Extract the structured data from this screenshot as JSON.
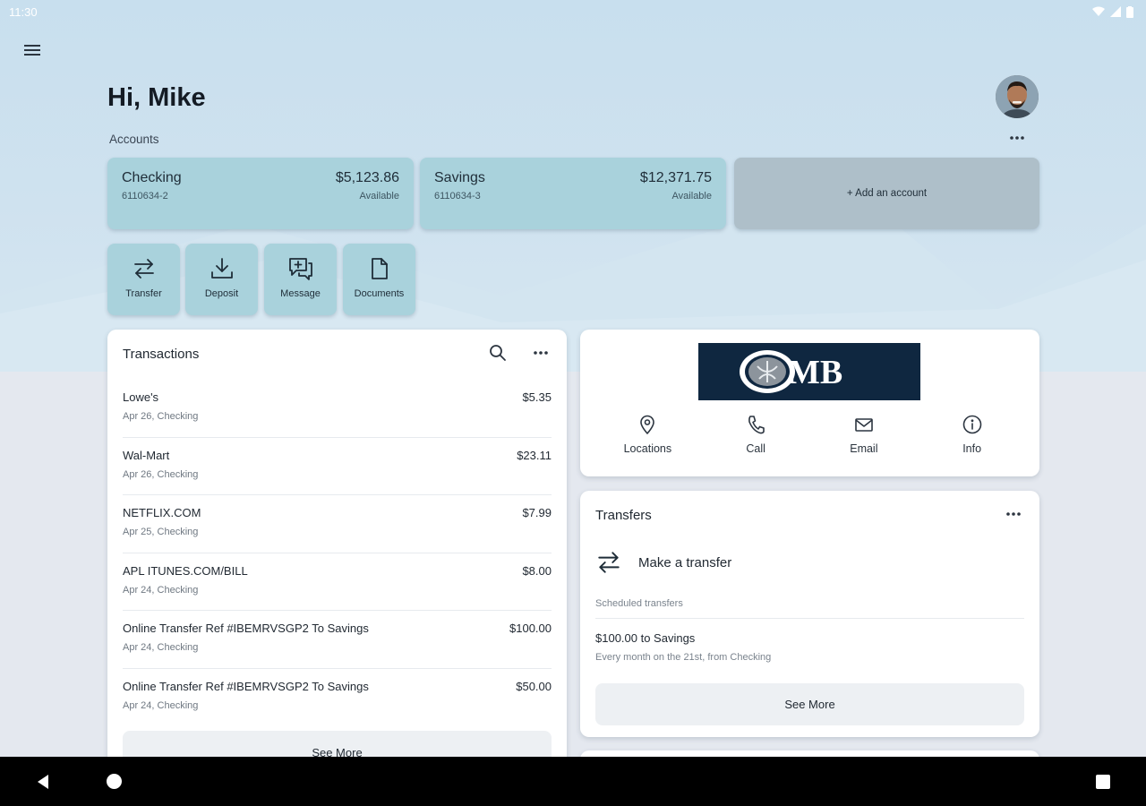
{
  "status_bar": {
    "time": "11:30"
  },
  "header": {
    "greeting": "Hi, Mike"
  },
  "accounts": {
    "label": "Accounts",
    "items": [
      {
        "name": "Checking",
        "number": "6110634-2",
        "amount": "$5,123.86",
        "available_label": "Available"
      },
      {
        "name": "Savings",
        "number": "6110634-3",
        "amount": "$12,371.75",
        "available_label": "Available"
      }
    ],
    "add_label": "+ Add an account"
  },
  "actions": [
    {
      "label": "Transfer",
      "icon": "transfer-icon"
    },
    {
      "label": "Deposit",
      "icon": "deposit-icon"
    },
    {
      "label": "Message",
      "icon": "message-icon"
    },
    {
      "label": "Documents",
      "icon": "document-icon"
    }
  ],
  "transactions": {
    "title": "Transactions",
    "items": [
      {
        "description": "Lowe's",
        "sub": "Apr 26, Checking",
        "amount": "$5.35"
      },
      {
        "description": "Wal-Mart",
        "sub": "Apr 26, Checking",
        "amount": "$23.11"
      },
      {
        "description": "NETFLIX.COM",
        "sub": "Apr 25, Checking",
        "amount": "$7.99"
      },
      {
        "description": "APL ITUNES.COM/BILL",
        "sub": "Apr 24, Checking",
        "amount": "$8.00"
      },
      {
        "description": "Online Transfer Ref #IBEMRVSGP2 To Savings",
        "sub": "Apr 24, Checking",
        "amount": "$100.00"
      },
      {
        "description": "Online Transfer Ref #IBEMRVSGP2 To Savings",
        "sub": "Apr 24, Checking",
        "amount": "$50.00"
      }
    ],
    "see_more": "See More"
  },
  "bank": {
    "logo_text": "MB",
    "actions": [
      {
        "label": "Locations",
        "icon": "location-pin-icon"
      },
      {
        "label": "Call",
        "icon": "phone-icon"
      },
      {
        "label": "Email",
        "icon": "email-icon"
      },
      {
        "label": "Info",
        "icon": "info-icon"
      }
    ]
  },
  "transfers": {
    "title": "Transfers",
    "make_transfer": "Make a transfer",
    "scheduled_label": "Scheduled transfers",
    "scheduled": [
      {
        "title": "$100.00 to Savings",
        "sub": "Every month on the 21st, from Checking"
      }
    ],
    "see_more": "See More"
  },
  "colors": {
    "card_teal": "#a9d2dc",
    "add_account_gray": "#aebfc9",
    "logo_navy": "#0f2740"
  }
}
